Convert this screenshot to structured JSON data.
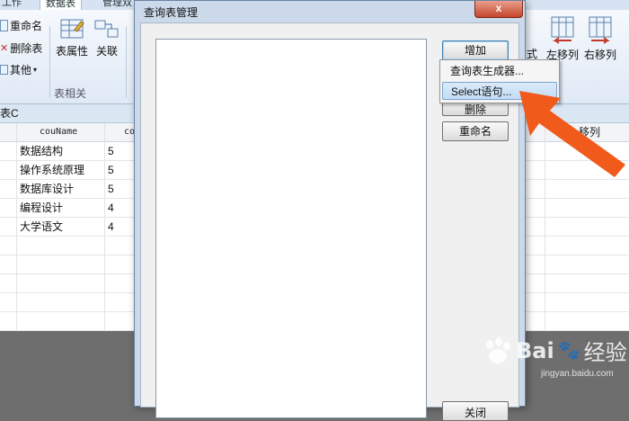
{
  "ribbon": {
    "tabs": [
      "工作",
      "数据表",
      "管理双"
    ],
    "small_buttons": [
      "重命名",
      "删除表",
      "其他"
    ],
    "big_buttons": [
      "表属性",
      "关联"
    ],
    "right_buttons": [
      "左移列",
      "右移列"
    ],
    "partial_label": "式",
    "group_label": "表相关"
  },
  "table": {
    "title": "表C",
    "columns": [
      "couName",
      "co"
    ],
    "right_header": "移列",
    "rows": [
      {
        "name": "数据结构",
        "value": "5"
      },
      {
        "name": "操作系统原理",
        "value": "5"
      },
      {
        "name": "数据库设计",
        "value": "5"
      },
      {
        "name": "编程设计",
        "value": "4"
      },
      {
        "name": "大学语文",
        "value": "4"
      }
    ]
  },
  "dialog": {
    "title": "查询表管理",
    "close_label": "x",
    "buttons": {
      "add": "增加",
      "delete_partial": "删除",
      "rename": "重命名",
      "close_partial": "关闭"
    }
  },
  "context_menu": {
    "items": [
      "查询表生成器...",
      "Select语句..."
    ],
    "highlighted_index": 1
  },
  "watermark": {
    "brand": "Bai",
    "suffix": "经验",
    "url": "jingyan.baidu.com"
  },
  "colors": {
    "arrow": "#f05a1a",
    "close_button": "#c5442b",
    "dialog_frame": "#cbd9ea"
  }
}
